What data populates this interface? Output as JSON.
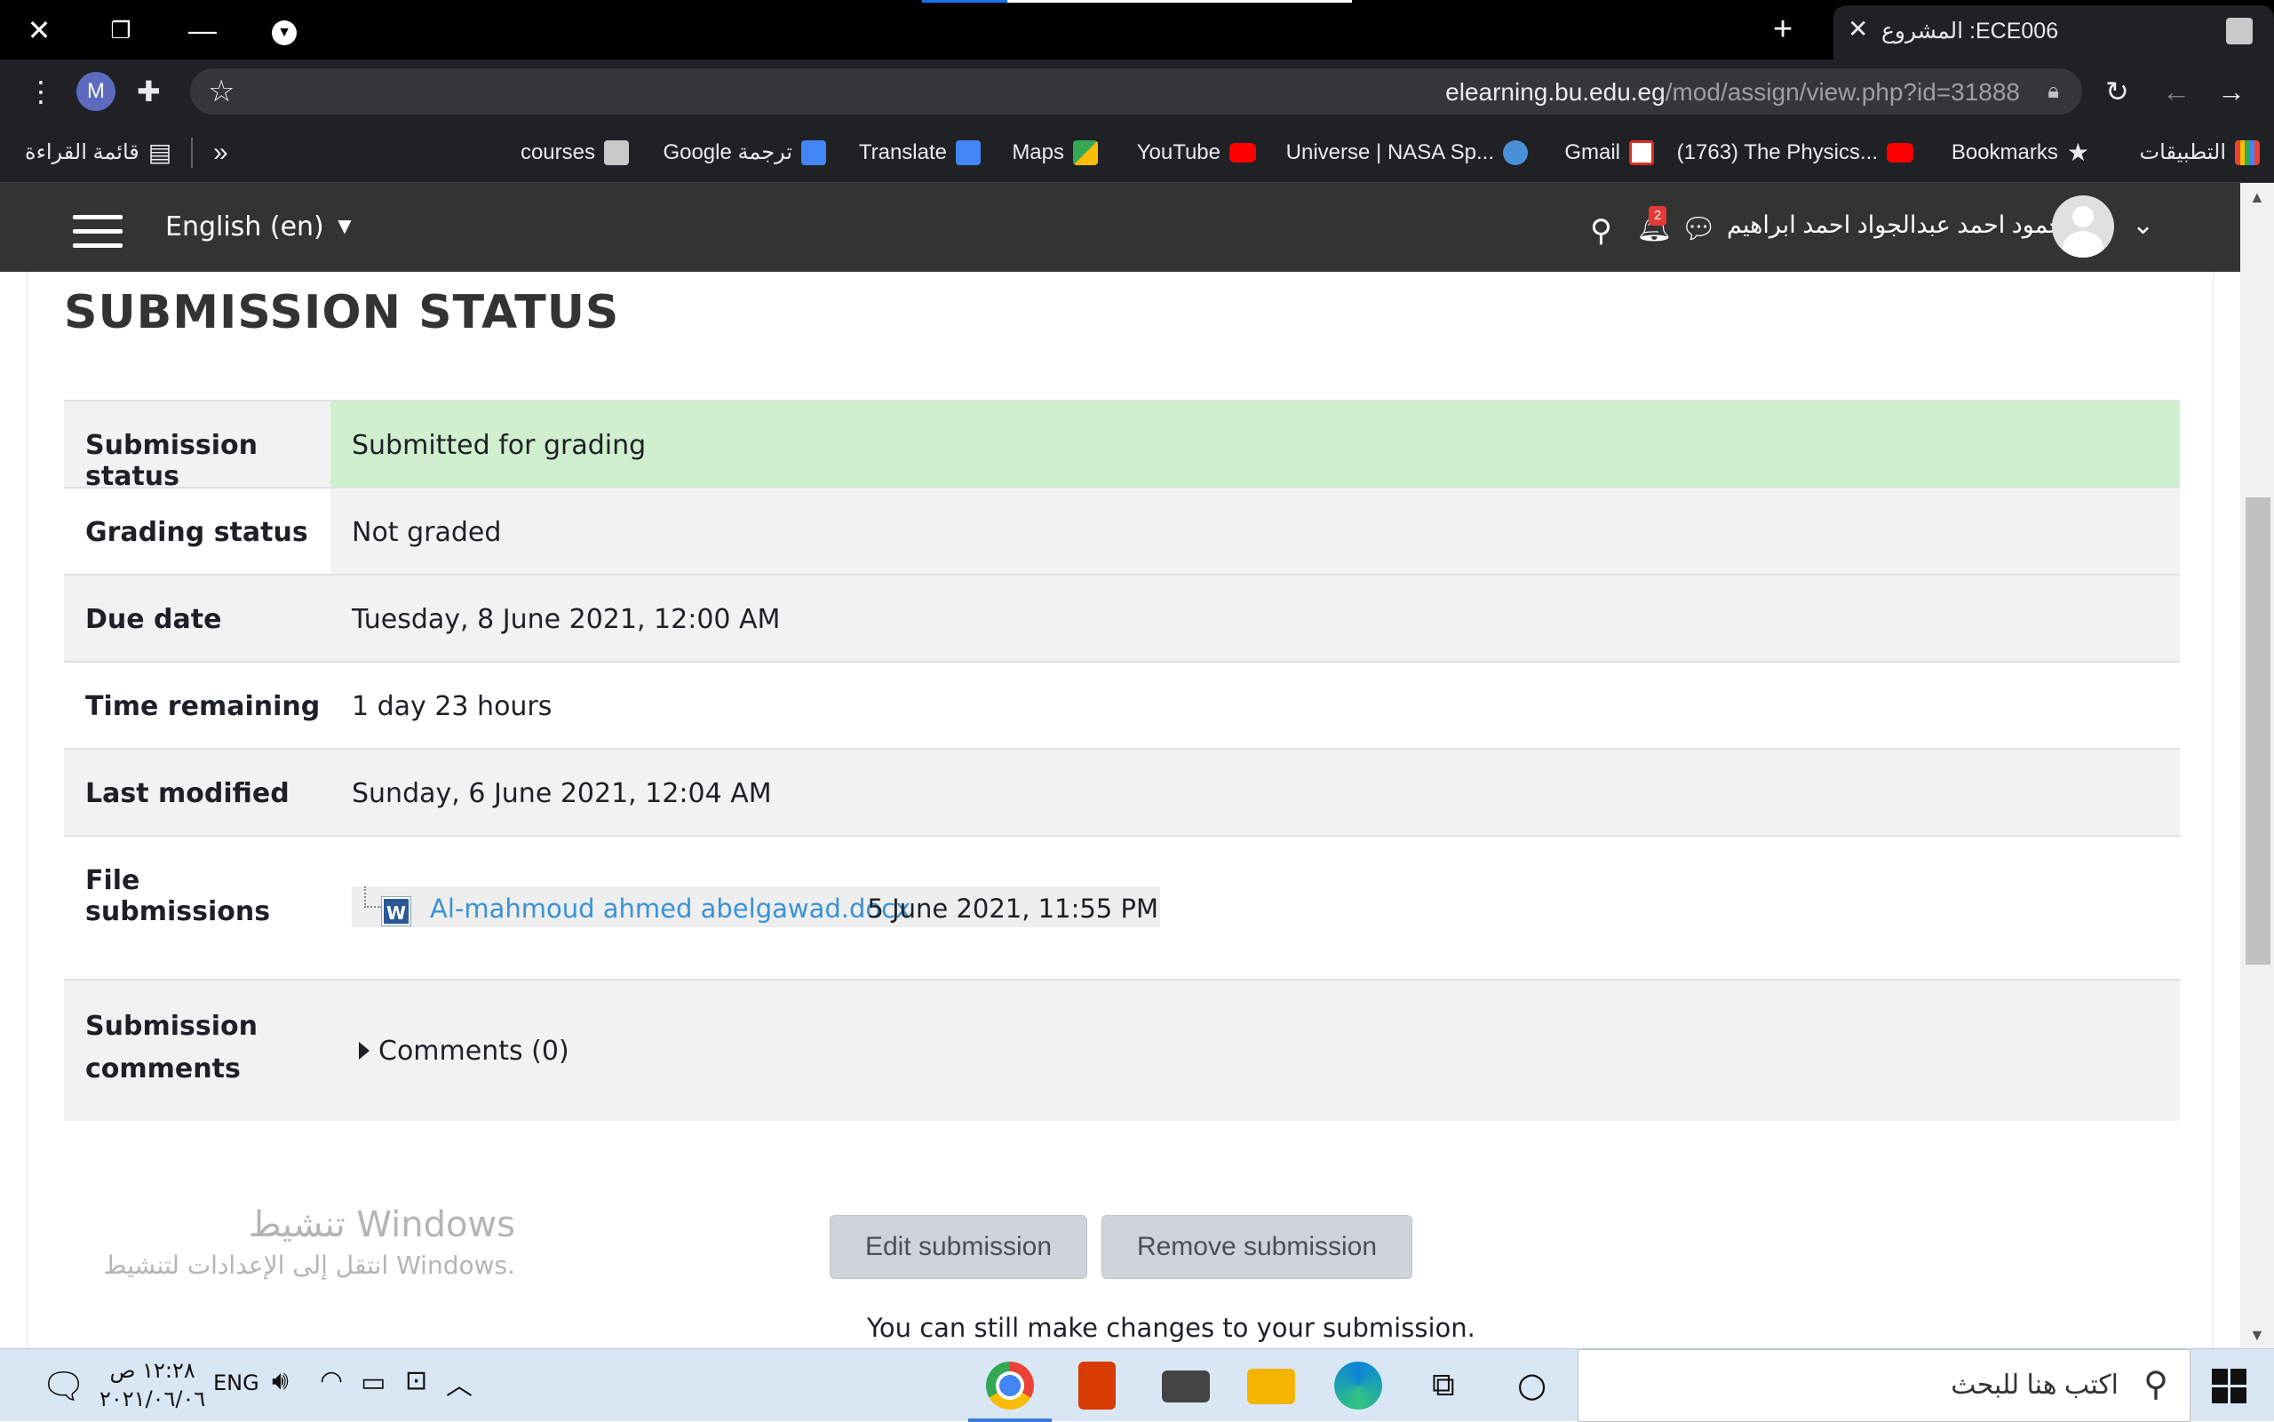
{
  "browser": {
    "tab_title": "المشروع :ECE006",
    "new_tab_label": "+",
    "url_domain": "elearning.bu.edu.eg",
    "url_path": "/mod/assign/view.php?id=31888",
    "profile_initial": "M",
    "bookmarks": [
      {
        "label": "التطبيقات",
        "color": "#ea4335"
      },
      {
        "label": "Bookmarks",
        "color": "#e8eaed"
      },
      {
        "label": "(1763) The Physics...",
        "color": "#ff0000"
      },
      {
        "label": "Gmail",
        "color": "#d93025"
      },
      {
        "label": "Universe | NASA Sp...",
        "color": "#4a90d9"
      },
      {
        "label": "YouTube",
        "color": "#ff0000"
      },
      {
        "label": "Maps",
        "color": "#34a853"
      },
      {
        "label": "Translate",
        "color": "#4285f4"
      },
      {
        "label": "Google ترجمة",
        "color": "#4285f4"
      },
      {
        "label": "courses",
        "color": "#c9c9c9"
      },
      {
        "label": "»",
        "color": ""
      },
      {
        "label": "قائمة القراءة",
        "color": ""
      }
    ]
  },
  "navbar": {
    "language": "English (en)",
    "notification_count": "2",
    "username": "محمود احمد عبدالجواد احمد ابراهيم"
  },
  "page": {
    "section_title": "SUBMISSION STATUS",
    "rows": [
      {
        "label": "Submission status",
        "value": "Submitted for grading"
      },
      {
        "label": "Grading status",
        "value": "Not graded"
      },
      {
        "label": "Due date",
        "value": "Tuesday, 8 June 2021, 12:00 AM"
      },
      {
        "label": "Time remaining",
        "value": "1 day 23 hours"
      },
      {
        "label": "Last modified",
        "value": "Sunday, 6 June 2021, 12:04 AM"
      },
      {
        "label": "File submissions",
        "value": ""
      },
      {
        "label": "Submission comments",
        "value": ""
      }
    ],
    "file": {
      "name": "Al-mahmoud ahmed abelgawad.docx",
      "date": "5 June 2021, 11:55 PM",
      "icon_letter": "W"
    },
    "comments_label": "Comments (0)",
    "edit_button": "Edit submission",
    "remove_button": "Remove submission",
    "hint": "You can still make changes to your submission.",
    "windows_activation": {
      "title": "تنشيط Windows",
      "subtitle": "انتقل إلى الإعدادات لتنشيط Windows."
    }
  },
  "taskbar": {
    "time": "١٢:٢٨ ص",
    "date": "٢٠٢١/٠٦/٠٦",
    "language": "ENG",
    "search_placeholder": "اكتب هنا للبحث",
    "colors": {
      "chrome": "#4285f4",
      "office": "#d83b01",
      "explorer": "#f4b400",
      "edge": "#0a84d8"
    }
  }
}
